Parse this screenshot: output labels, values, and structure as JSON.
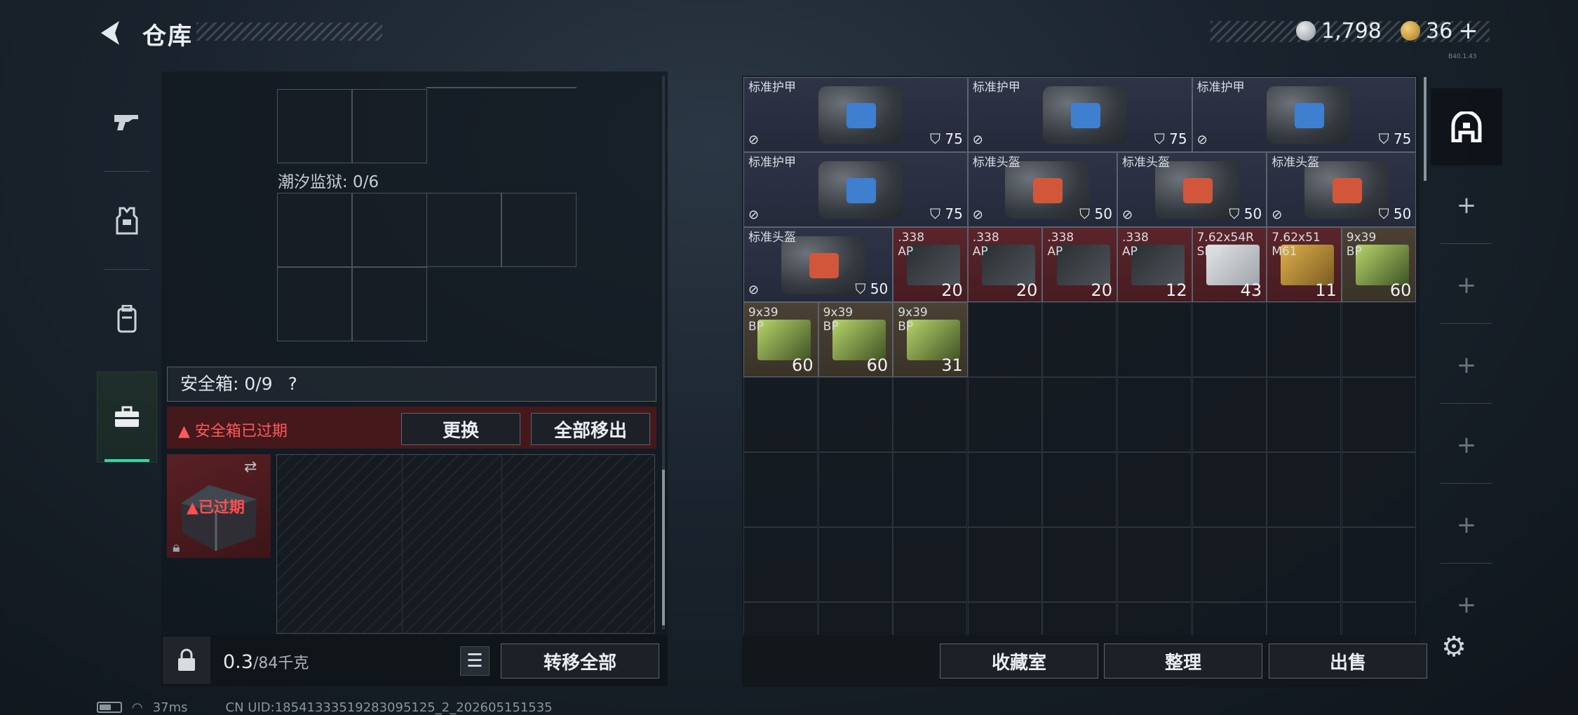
{
  "header": {
    "title": "仓库",
    "currency": {
      "money": "1,798",
      "tokens": "36",
      "plus": "+"
    },
    "version": "B40.1.43"
  },
  "left_tabs": [
    {
      "id": "weapons",
      "icon": "pistol-icon",
      "active": false
    },
    {
      "id": "armor",
      "icon": "vest-icon",
      "active": false
    },
    {
      "id": "backpack",
      "icon": "backpack-icon",
      "active": false
    },
    {
      "id": "safebox",
      "icon": "briefcase-icon",
      "active": true
    }
  ],
  "storage": {
    "prison_label": "潮汐监狱: 0/6",
    "safe_label": "安全箱: 0/9",
    "help": "?",
    "expired_warning": "安全箱已过期",
    "replace_btn": "更换",
    "move_all_btn": "全部移出",
    "expired_tag": "已过期",
    "weight_value": "0.3",
    "weight_unit": "/84千克",
    "transfer_all_btn": "转移全部"
  },
  "inventory": [
    {
      "name": "标准护甲",
      "type": "armor",
      "durability": "75"
    },
    {
      "name": "标准护甲",
      "type": "armor",
      "durability": "75"
    },
    {
      "name": "标准护甲",
      "type": "armor",
      "durability": "75"
    },
    {
      "name": "标准护甲",
      "type": "armor",
      "durability": "75"
    },
    {
      "name": "标准头盔",
      "type": "helmet",
      "durability": "50"
    },
    {
      "name": "标准头盔",
      "type": "helmet",
      "durability": "50"
    },
    {
      "name": "标准头盔",
      "type": "helmet",
      "durability": "50"
    },
    {
      "name": "标准头盔",
      "type": "helmet",
      "durability": "50"
    },
    {
      "name": ".338\nAP",
      "type": "ammo-red",
      "qty": "20"
    },
    {
      "name": ".338\nAP",
      "type": "ammo-red",
      "qty": "20"
    },
    {
      "name": ".338\nAP",
      "type": "ammo-red",
      "qty": "20"
    },
    {
      "name": ".338\nAP",
      "type": "ammo-red",
      "qty": "12"
    },
    {
      "name": "7.62x54R\nSNB",
      "type": "ammo-white",
      "qty": "43"
    },
    {
      "name": "7.62x51\nM61",
      "type": "ammo-yellow",
      "qty": "11"
    },
    {
      "name": "9x39\nBP",
      "type": "ammo-green",
      "qty": "60"
    },
    {
      "name": "9x39\nBP",
      "type": "ammo-green",
      "qty": "60"
    },
    {
      "name": "9x39\nBP",
      "type": "ammo-green",
      "qty": "60"
    },
    {
      "name": "9x39\nBP",
      "type": "ammo-green",
      "qty": "31"
    }
  ],
  "bottom_buttons": {
    "collection": "收藏室",
    "sort": "整理",
    "sell": "出售"
  },
  "right_tabs": {
    "active_icon": "dome-icon",
    "add": "+"
  },
  "status": {
    "ping": "37ms",
    "uid": "CN UID:18541333519283095125_2_202605151535"
  },
  "colors": {
    "accent": "#2fd9a6",
    "warning": "#ff5a5a",
    "armor_plate": "#3f7fd0",
    "helmet_plate": "#d2573a"
  }
}
